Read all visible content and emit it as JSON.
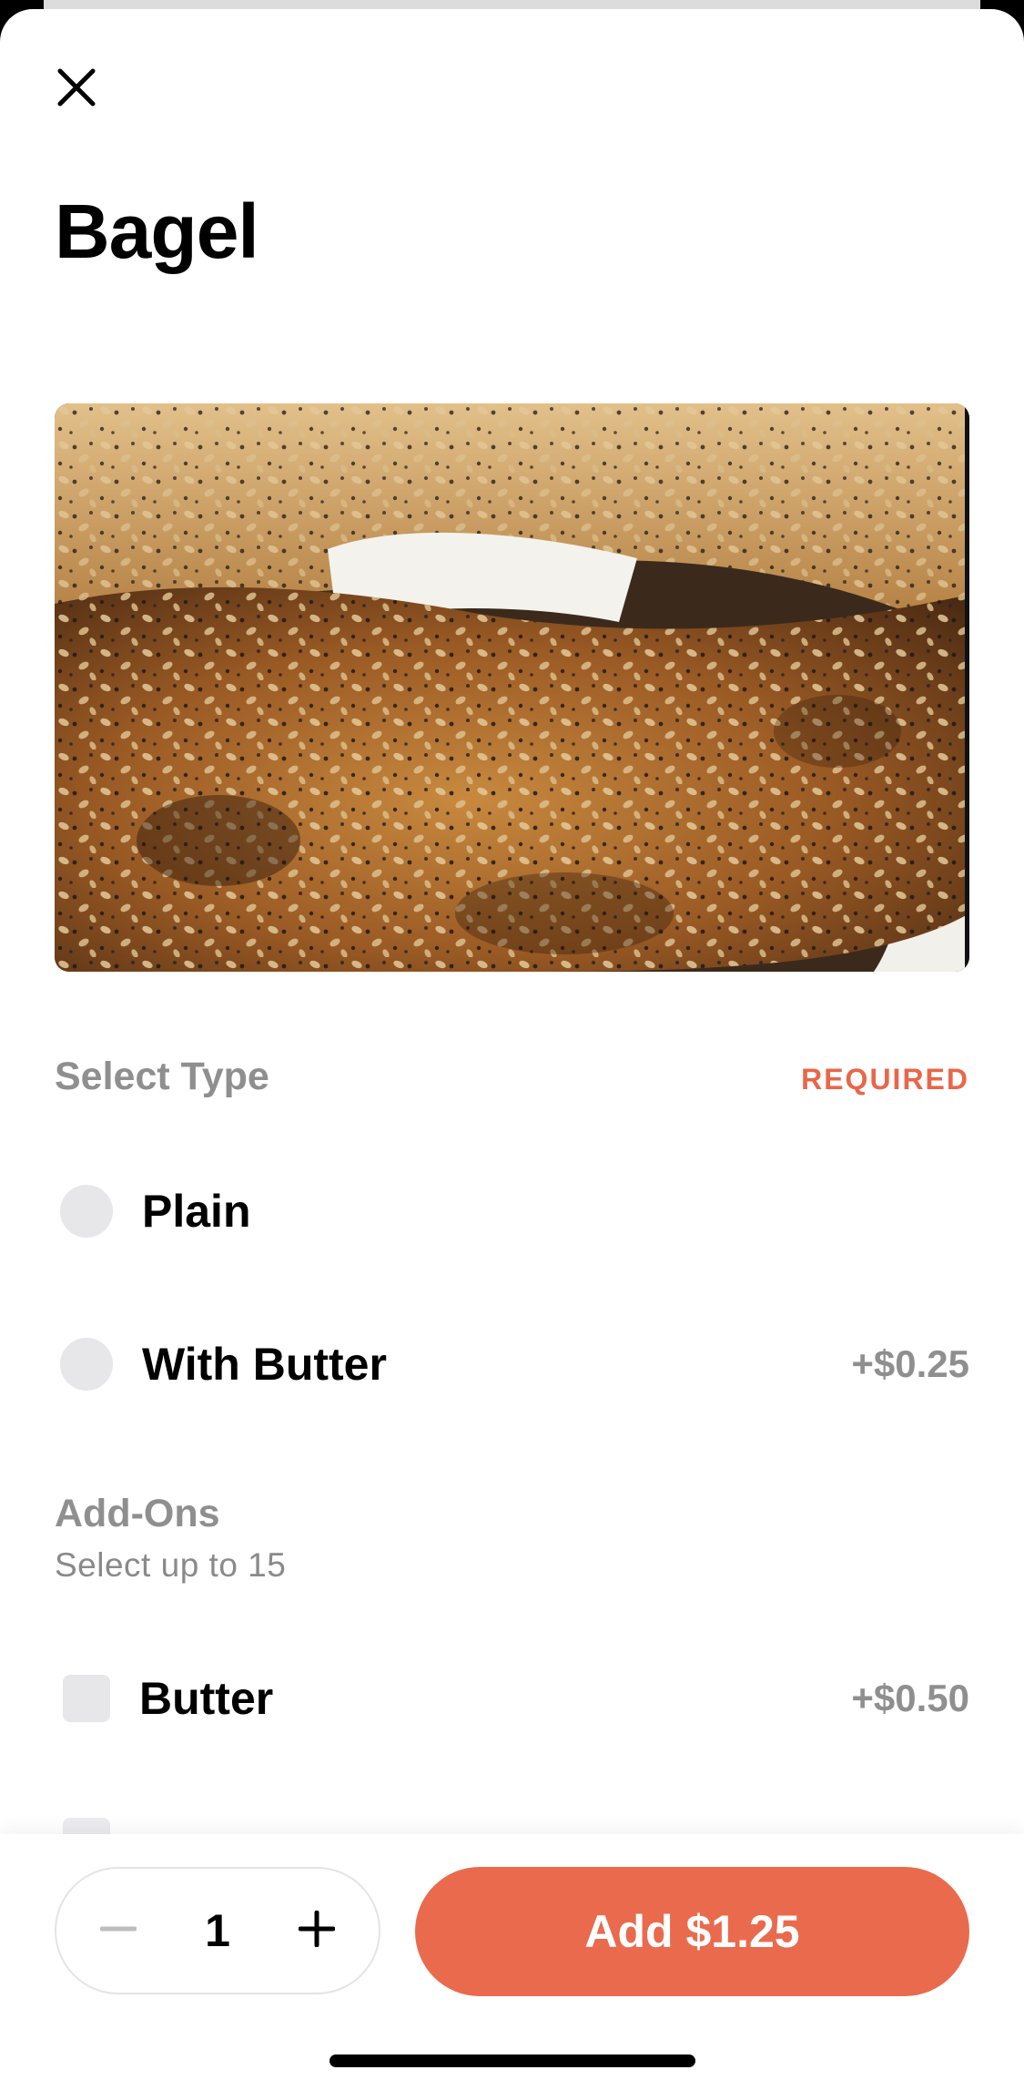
{
  "item": {
    "title": "Bagel",
    "image_alt": "Everything bagel with cream cheese"
  },
  "select_type": {
    "title": "Select Type",
    "badge": "REQUIRED",
    "options": [
      {
        "label": "Plain",
        "price": ""
      },
      {
        "label": "With Butter",
        "price": "+$0.25"
      }
    ]
  },
  "add_ons": {
    "title": "Add-Ons",
    "subtitle": "Select up to 15",
    "options": [
      {
        "label": "Butter",
        "price": "+$0.50"
      }
    ]
  },
  "footer": {
    "quantity": "1",
    "add_label": "Add $1.25"
  },
  "icons": {
    "close": "close-icon",
    "minus": "minus-icon",
    "plus": "plus-icon"
  },
  "colors": {
    "accent": "#ea6a4d",
    "required": "#e8674a",
    "muted": "#8f8f8f",
    "control_fill": "#e7e7ea"
  }
}
